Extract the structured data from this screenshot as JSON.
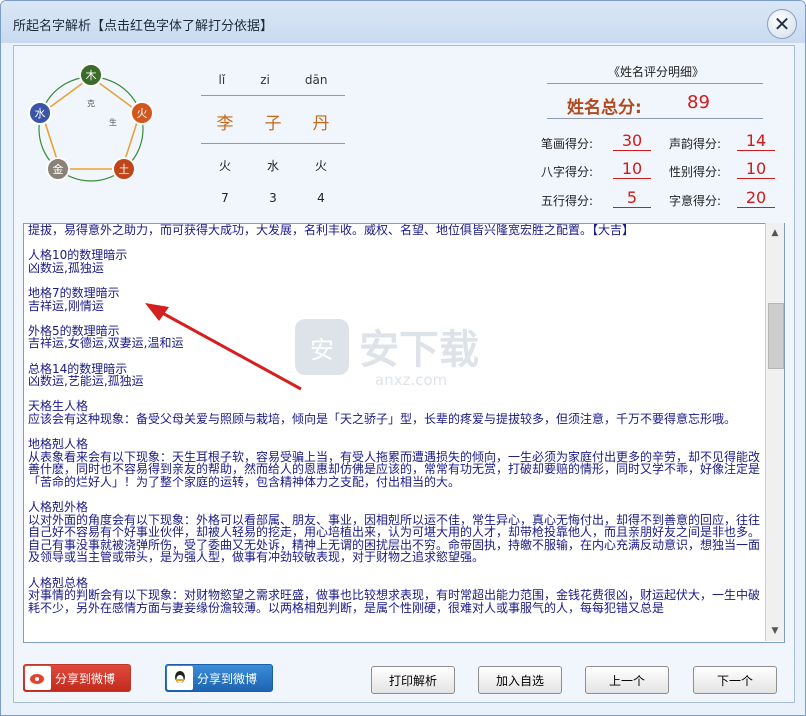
{
  "window": {
    "title": "所起名字解析【点击红色字体了解打分依据】"
  },
  "name": {
    "pinyin": [
      "lǐ",
      "zi",
      "dān"
    ],
    "chars": [
      "李",
      "子",
      "丹"
    ],
    "wuxing": [
      "火",
      "水",
      "火"
    ],
    "strokes": [
      "7",
      "3",
      "4"
    ]
  },
  "wuxing_diagram": {
    "elements": [
      "木",
      "火",
      "土",
      "金",
      "水"
    ],
    "relations": [
      "生",
      "克"
    ]
  },
  "scores": {
    "caption": "《姓名评分明细》",
    "total_label": "姓名总分:",
    "total_value": "89",
    "items": [
      {
        "label": "笔画得分:",
        "value": "30"
      },
      {
        "label": "声韵得分:",
        "value": "14"
      },
      {
        "label": "八字得分:",
        "value": "10"
      },
      {
        "label": "性别得分:",
        "value": "10"
      },
      {
        "label": "五行得分:",
        "value": "5"
      },
      {
        "label": "字意得分:",
        "value": "20"
      }
    ]
  },
  "analysis": {
    "lines": [
      "提拔，易得意外之助力，而可获得大成功，大发展，名利丰收。威权、名望、地位俱皆兴隆宽宏胜之配置。【大吉】",
      "",
      "人格10的数理暗示",
      "凶数运,孤独运",
      "",
      "地格7的数理暗示",
      "吉祥运,刚情运",
      "",
      "外格5的数理暗示",
      "吉祥运,女德运,双妻运,温和运",
      "",
      "总格14的数理暗示",
      "凶数运,艺能运,孤独运",
      "",
      "天格生人格",
      "应该会有这种现象：备受父母关爱与照顾与栽培，倾向是「天之骄子」型，长辈的疼爱与提拔较多，但须注意，千万不要得意忘形哦。",
      "",
      "地格剋人格",
      "从表象看来会有以下现象：天生耳根子软，容易受骗上当，有受人拖累而遭遇损失的倾向，一生必须为家庭付出更多的辛劳，却不见得能改善什麽，同时也不容易得到亲友的帮助，然而给人的恩惠却仿佛是应该的，常常有功无赏，打破却要赔的情形，同时又学不乖，好像注定是「苦命的烂好人」！为了整个家庭的运转，包含精神体力之支配，付出相当的大。",
      "",
      "人格剋外格",
      "以对外面的角度会有以下现象：外格可以看部属、朋友、事业，因相剋所以运不佳，常生异心，真心无悔付出，却得不到善意的回应，往往自己好不容易有个好事业伙伴，却被人轻易的挖走，用心培植出来，认为可堪大用的人才，却带枪投靠他人，而且亲朋好友之间是非也多。自己有事没事就被浇弹所伤，受了委曲又无处诉，精神上无谓的困扰层出不穷。命带固执，持皦不服输，在内心充满反动意识，想独当一面及领导或当主管或带头，是为强人型，做事有冲劲较敏表现，对于财物之追求慾望强。",
      "",
      "人格剋总格",
      "对事情的判断会有以下现象：对财物慾望之需求旺盛，做事也比较想求表现，有时常超出能力范围，金钱花费很凶，财运起伏大，一生中破耗不少，另外在感情方面与妻妾缘份澹较薄。以两格相剋判断，是属个性刚硬，很难对人或事服气的人，每每犯错又总是"
    ]
  },
  "watermark": {
    "brand": "安下载",
    "url": "anxz.com",
    "shield_glyph": "安"
  },
  "buttons": {
    "share_weibo": "分享到微博",
    "share_qq": "分享到微博",
    "print": "打印解析",
    "add_favorite": "加入自选",
    "prev": "上一个",
    "next": "下一个"
  },
  "colors": {
    "score_red": "#d11a1a",
    "text_blue": "#1a1a8a",
    "char_orange": "#c46a1a"
  }
}
